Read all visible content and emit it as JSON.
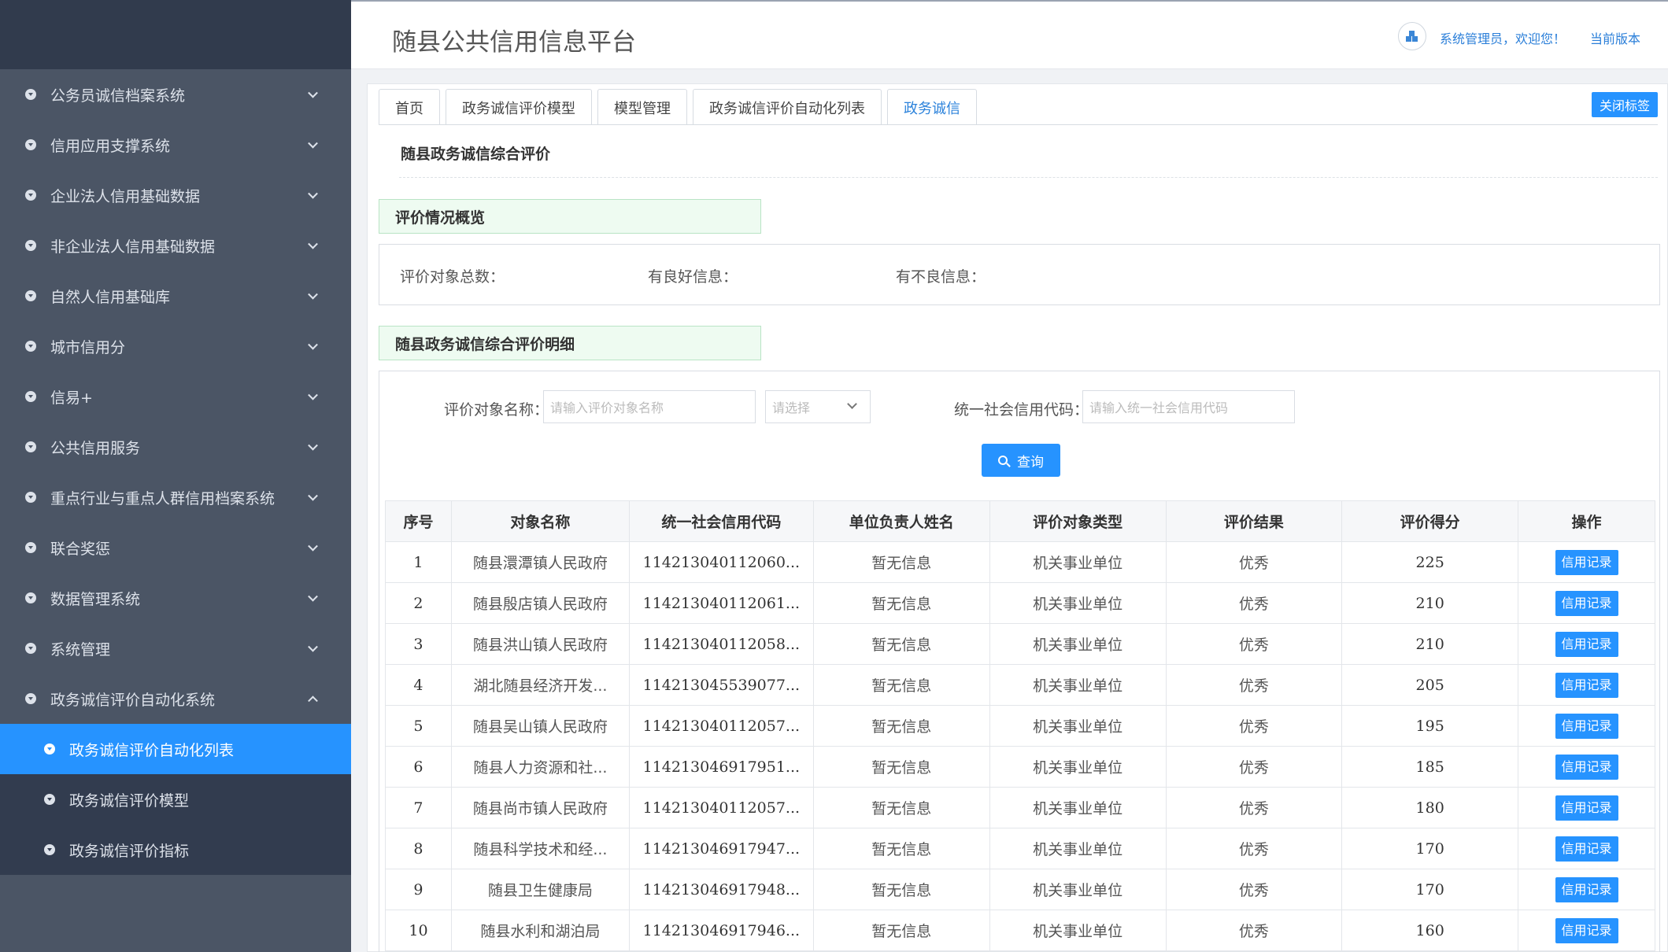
{
  "header": {
    "title": "随县公共信用信息平台",
    "user_text": "系统管理员，欢迎您！",
    "version": "当前版本"
  },
  "sidebar": {
    "items": [
      {
        "label": "公务员诚信档案系统"
      },
      {
        "label": "信用应用支撑系统"
      },
      {
        "label": "企业法人信用基础数据"
      },
      {
        "label": "非企业法人信用基础数据"
      },
      {
        "label": "自然人信用基础库"
      },
      {
        "label": "城市信用分"
      },
      {
        "label": "信易+"
      },
      {
        "label": "公共信用服务"
      },
      {
        "label": "重点行业与重点人群信用档案系统"
      },
      {
        "label": "联合奖惩"
      },
      {
        "label": "数据管理系统"
      },
      {
        "label": "系统管理"
      },
      {
        "label": "政务诚信评价自动化系统"
      }
    ],
    "sub_items": [
      {
        "label": "政务诚信评价自动化列表"
      },
      {
        "label": "政务诚信评价模型"
      },
      {
        "label": "政务诚信评价指标"
      }
    ]
  },
  "tabs": [
    {
      "label": "首页"
    },
    {
      "label": "政务诚信评价模型"
    },
    {
      "label": "模型管理"
    },
    {
      "label": "政务诚信评价自动化列表"
    },
    {
      "label": "政务诚信"
    }
  ],
  "close_tags": "关闭标签",
  "page_title": "随县政务诚信综合评价",
  "overview": {
    "title": "评价情况概览",
    "total_label": "评价对象总数：",
    "good_label": "有良好信息：",
    "bad_label": "有不良信息："
  },
  "detail": {
    "title": "随县政务诚信综合评价明细",
    "name_label": "评价对象名称：",
    "name_placeholder": "请输入评价对象名称",
    "select_placeholder": "请选择",
    "code_label": "统一社会信用代码：",
    "code_placeholder": "请输入统一社会信用代码",
    "query": "查询"
  },
  "table": {
    "headers": [
      "序号",
      "对象名称",
      "统一社会信用代码",
      "单位负责人姓名",
      "评价对象类型",
      "评价结果",
      "评价得分",
      "操作"
    ],
    "rows": [
      [
        "1",
        "随县澴潭镇人民政府",
        "114213040112060...",
        "暂无信息",
        "机关事业单位",
        "优秀",
        "225",
        "信用记录"
      ],
      [
        "2",
        "随县殷店镇人民政府",
        "114213040112061...",
        "暂无信息",
        "机关事业单位",
        "优秀",
        "210",
        "信用记录"
      ],
      [
        "3",
        "随县洪山镇人民政府",
        "114213040112058...",
        "暂无信息",
        "机关事业单位",
        "优秀",
        "210",
        "信用记录"
      ],
      [
        "4",
        "湖北随县经济开发...",
        "114213045539077...",
        "暂无信息",
        "机关事业单位",
        "优秀",
        "205",
        "信用记录"
      ],
      [
        "5",
        "随县吴山镇人民政府",
        "114213040112057...",
        "暂无信息",
        "机关事业单位",
        "优秀",
        "195",
        "信用记录"
      ],
      [
        "6",
        "随县人力资源和社...",
        "114213046917951...",
        "暂无信息",
        "机关事业单位",
        "优秀",
        "185",
        "信用记录"
      ],
      [
        "7",
        "随县尚市镇人民政府",
        "114213040112057...",
        "暂无信息",
        "机关事业单位",
        "优秀",
        "180",
        "信用记录"
      ],
      [
        "8",
        "随县科学技术和经...",
        "114213046917947...",
        "暂无信息",
        "机关事业单位",
        "优秀",
        "170",
        "信用记录"
      ],
      [
        "9",
        "随县卫生健康局",
        "114213046917948...",
        "暂无信息",
        "机关事业单位",
        "优秀",
        "170",
        "信用记录"
      ],
      [
        "10",
        "随县水利和湖泊局",
        "114213046917946...",
        "暂无信息",
        "机关事业单位",
        "优秀",
        "160",
        "信用记录"
      ]
    ]
  },
  "colors": {
    "accent": "#2693ff",
    "sidebar_bg": "#4b5565",
    "sidebar_dark": "#323c4f",
    "section_green": "#eefbf1"
  }
}
